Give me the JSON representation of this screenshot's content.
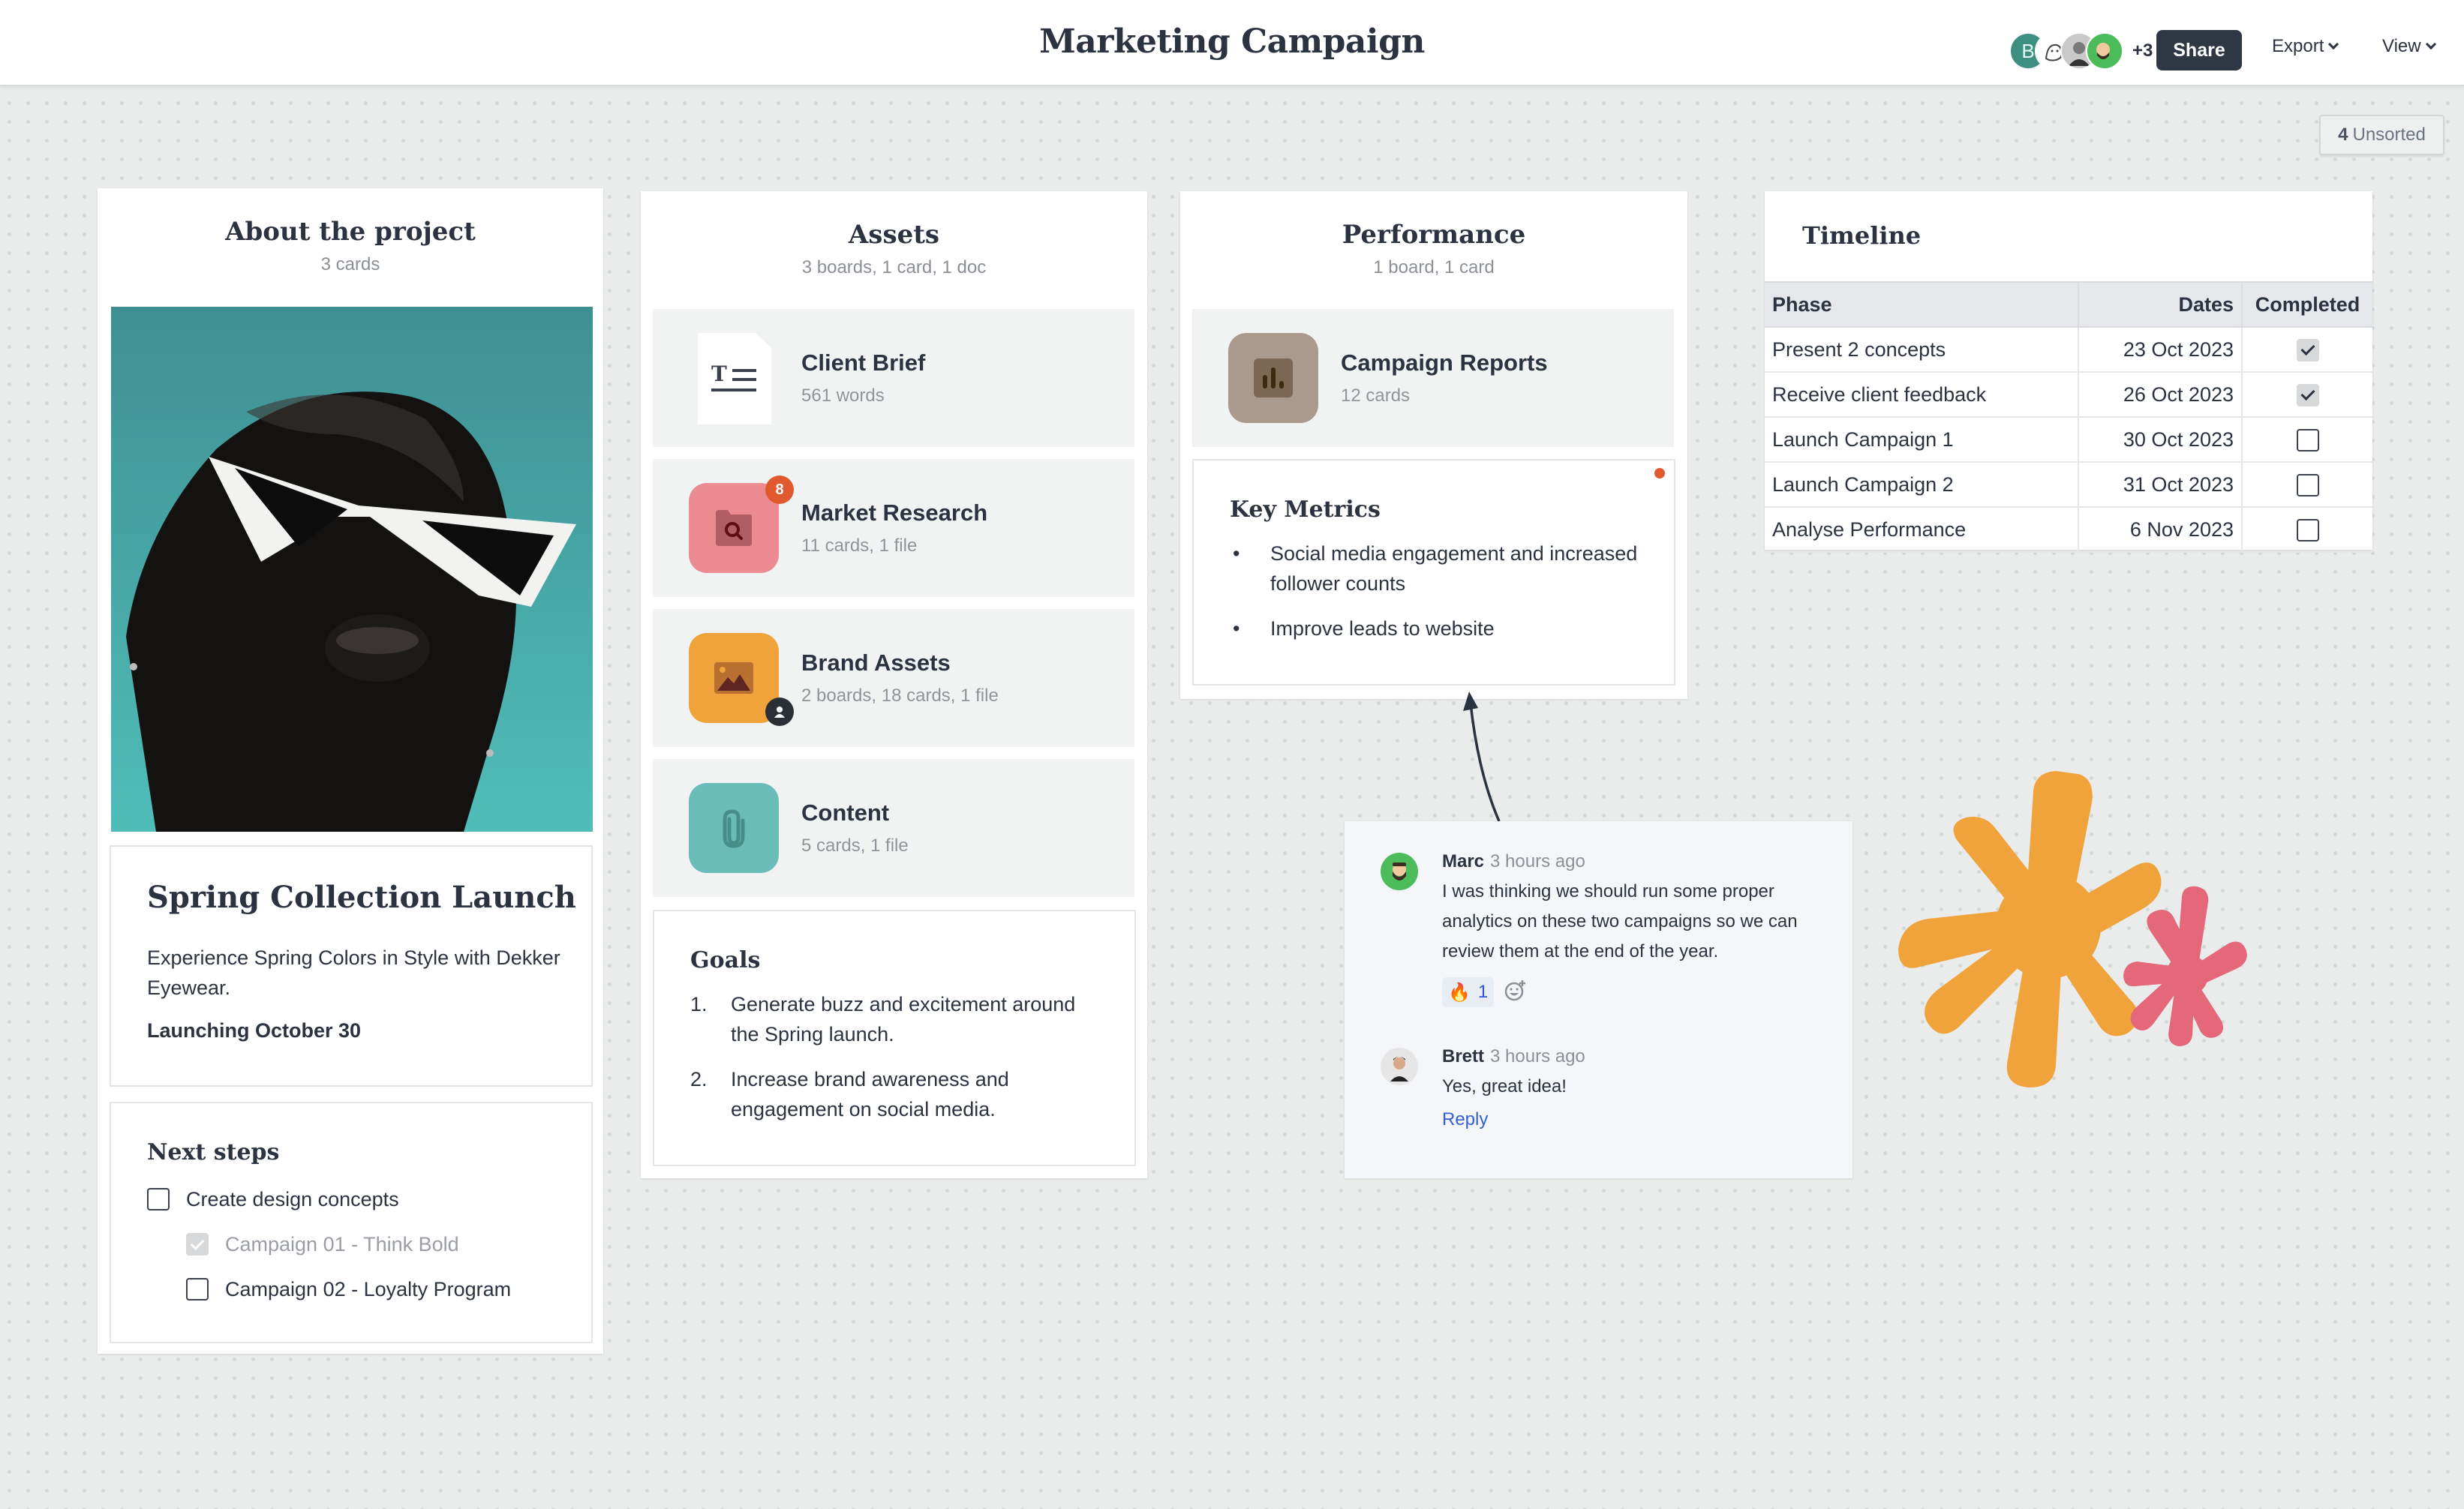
{
  "header": {
    "title": "Marketing Campaign",
    "avatars": [
      {
        "name": "avatar-b",
        "initial": "B"
      },
      {
        "name": "avatar-sketch",
        "initial": ""
      },
      {
        "name": "avatar-photo",
        "initial": ""
      },
      {
        "name": "avatar-memoji",
        "initial": ""
      }
    ],
    "extra_count": "+3",
    "share_label": "Share",
    "export_label": "Export",
    "view_label": "View"
  },
  "unsorted": {
    "count": "4",
    "label": "Unsorted"
  },
  "about": {
    "title": "About the project",
    "subtitle": "3 cards",
    "card_title": "Spring Collection Launch",
    "card_text": "Experience Spring Colors in Style with Dekker Eyewear.",
    "card_bold": "Launching October 30",
    "next_steps": {
      "title": "Next steps",
      "items": [
        {
          "label": "Create design concepts",
          "checked": false,
          "indent": 0
        },
        {
          "label": "Campaign 01 - Think Bold",
          "checked": true,
          "indent": 1
        },
        {
          "label": "Campaign 02 - Loyalty Program",
          "checked": false,
          "indent": 1
        }
      ]
    }
  },
  "assets": {
    "title": "Assets",
    "subtitle": "3 boards, 1 card, 1 doc",
    "items": [
      {
        "name": "Client Brief",
        "meta": "561 words",
        "icon": "document-icon"
      },
      {
        "name": "Market Research",
        "meta": "11 cards, 1 file",
        "icon": "folder-search-icon",
        "color": "#ec8b92",
        "badge": "8"
      },
      {
        "name": "Brand Assets",
        "meta": "2 boards, 18 cards, 1 file",
        "icon": "image-icon",
        "color": "#f0a33a"
      },
      {
        "name": "Content",
        "meta": "5 cards, 1 file",
        "icon": "paperclip-icon",
        "color": "#6bbcb8"
      }
    ],
    "goals": {
      "title": "Goals",
      "items": [
        {
          "num": "1.",
          "text": "Generate buzz and excitement around the Spring launch."
        },
        {
          "num": "2.",
          "text": "Increase brand awareness and engagement on social media."
        }
      ]
    }
  },
  "performance": {
    "title": "Performance",
    "subtitle": "1 board, 1 card",
    "board": {
      "name": "Campaign Reports",
      "meta": "12 cards",
      "icon": "bar-chart-icon",
      "color": "#a99a8d"
    },
    "metrics": {
      "title": "Key Metrics",
      "items": [
        "Social media engagement and increased follower counts",
        "Improve leads to website"
      ]
    }
  },
  "timeline": {
    "title": "Timeline",
    "columns": [
      "Phase",
      "Dates",
      "Completed"
    ],
    "rows": [
      {
        "phase": "Present 2 concepts",
        "date": "23 Oct 2023",
        "completed": true
      },
      {
        "phase": "Receive client feedback",
        "date": "26 Oct 2023",
        "completed": true
      },
      {
        "phase": "Launch Campaign 1",
        "date": "30 Oct 2023",
        "completed": false
      },
      {
        "phase": "Launch Campaign 2",
        "date": "31 Oct 2023",
        "completed": false
      },
      {
        "phase": "Analyse Performance",
        "date": "6 Nov 2023",
        "completed": false
      }
    ]
  },
  "comments": {
    "thread": [
      {
        "author": "Marc",
        "time": "3 hours ago",
        "text": "I was thinking we should run some proper analytics on these two campaigns so we can review them at the end of the year.",
        "reaction": {
          "emoji": "🔥",
          "count": "1"
        }
      },
      {
        "author": "Brett",
        "time": "3 hours ago",
        "text": "Yes, great idea!"
      }
    ],
    "reply_label": "Reply"
  },
  "colors": {
    "accent_dark": "#2f3745",
    "orange": "#f0a33a",
    "pink": "#e5677a",
    "notification_dot": "#e0592f"
  }
}
